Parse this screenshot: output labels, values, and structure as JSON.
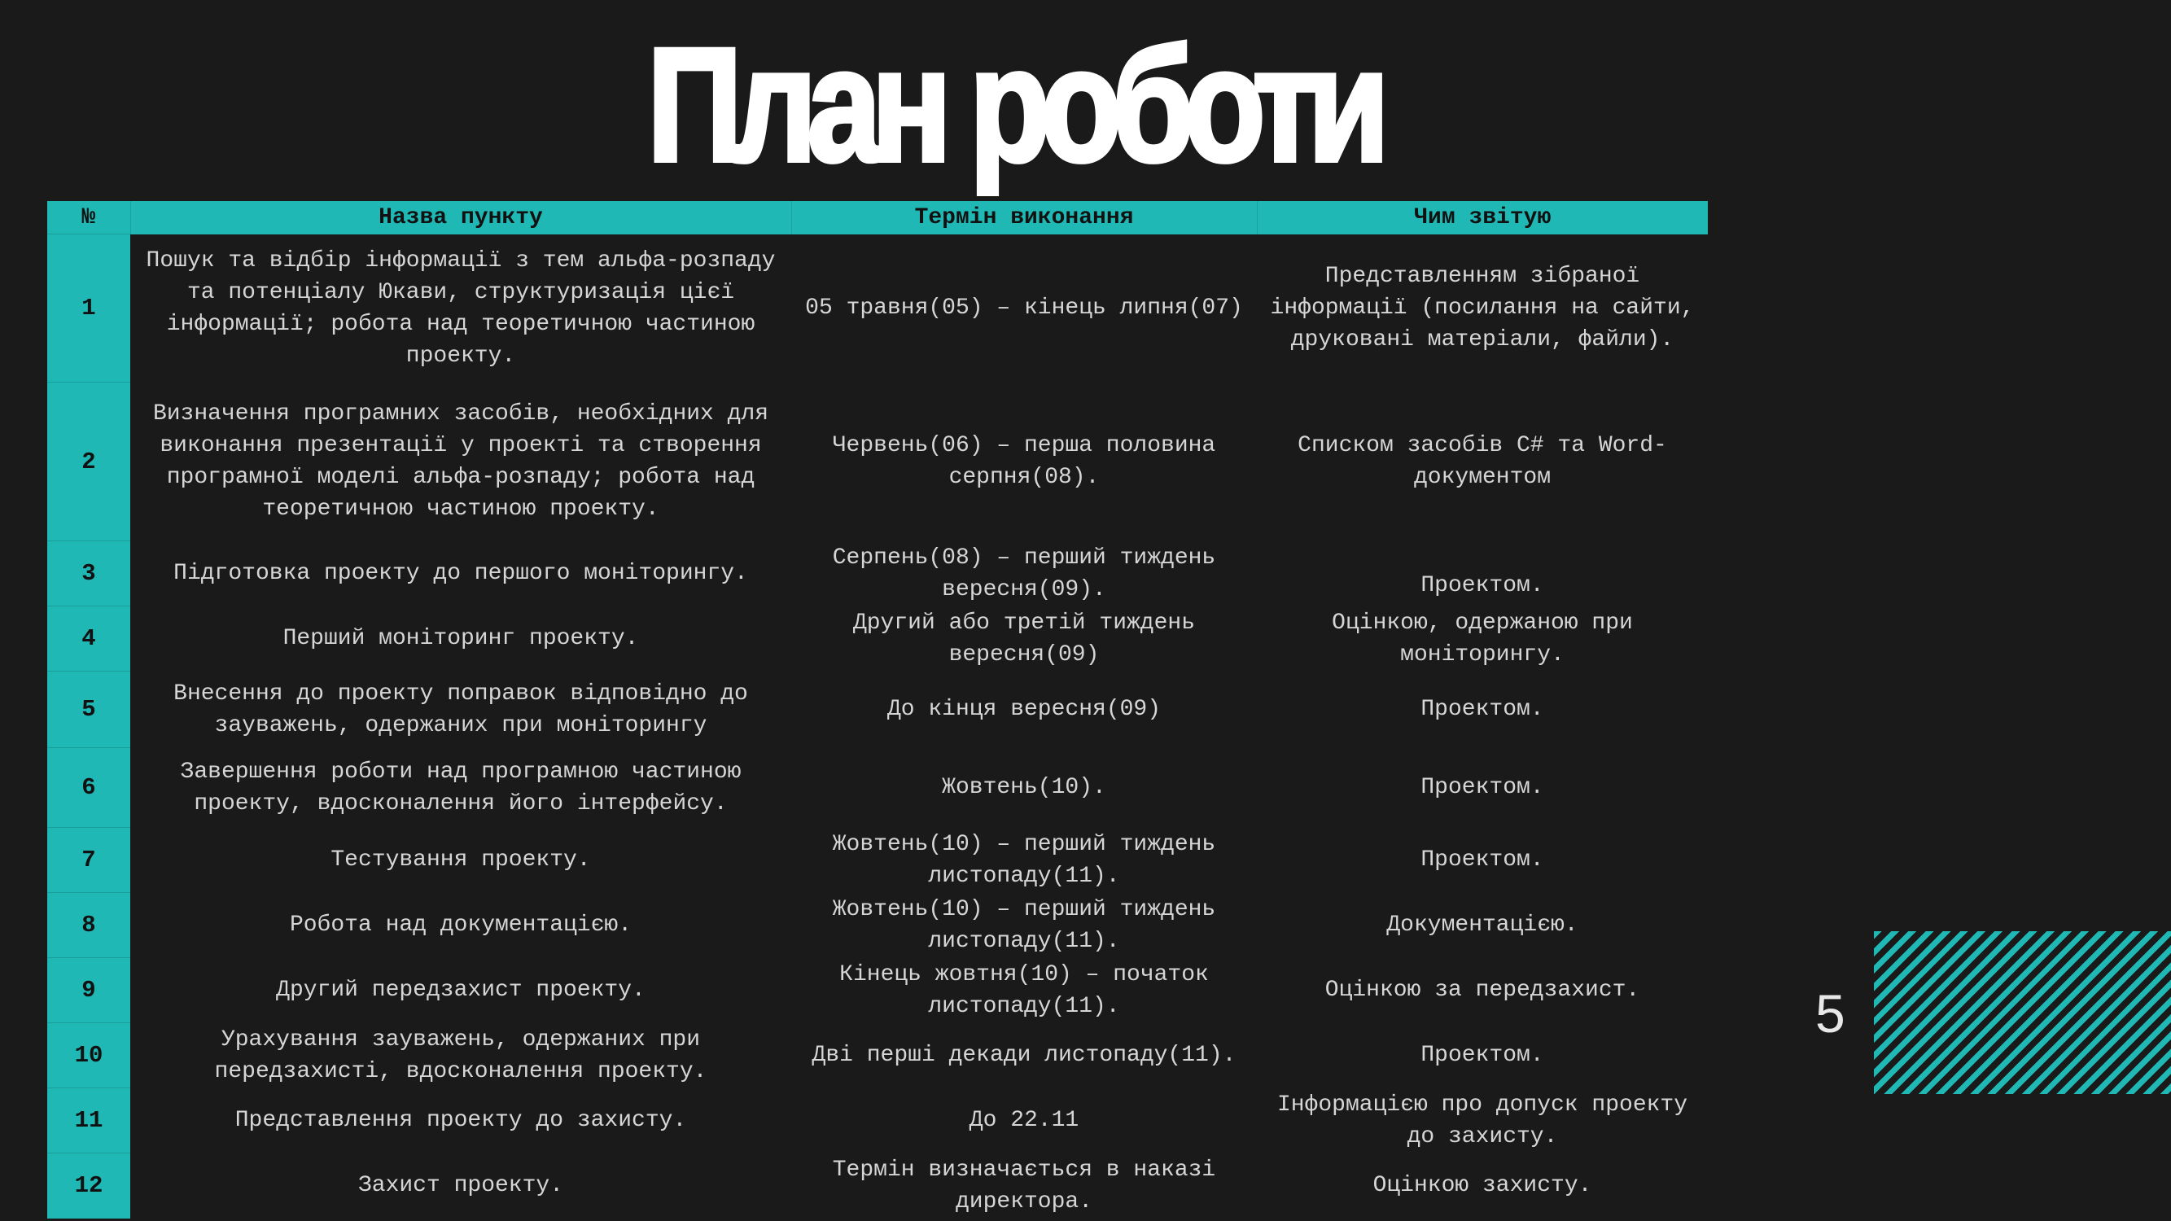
{
  "title": "План роботи",
  "page_number": "5",
  "colors": {
    "background": "#1a1a1a",
    "accent": "#1fb8b5",
    "text": "#d6d6d6",
    "title": "#ffffff"
  },
  "table": {
    "headers": {
      "number": "№",
      "name": "Назва пункту",
      "term": "Термін виконання",
      "report": "Чим звітую"
    },
    "rows": [
      {
        "number": "1",
        "name": "Пошук та відбір інформації з тем альфа-розпаду та потенціалу Юкави, структуризація цієї інформації; робота над теоретичною частиною проекту.",
        "term": "05 травня(05) – кінець липня(07)",
        "report": "Представленням зібраної інформації  (посилання на сайти, друковані матеріали, файли)."
      },
      {
        "number": "2",
        "name": "Визначення програмних засобів, необхідних для виконання презентації у проекті та створення програмної моделі альфа-розпаду; робота над теоретичною частиною проекту.",
        "term": "Червень(06) – перша половина серпня(08).",
        "report": "Списком засобів C# та Word-документом"
      },
      {
        "number": "3",
        "name": "Підготовка проекту до першого моніторингу.",
        "term": "Серпень(08) – перший тиждень вересня(09).",
        "report": "Проектом."
      },
      {
        "number": "4",
        "name": "Перший моніторинг проекту.",
        "term": "Другий або третій тиждень вересня(09)",
        "report": "Оцінкою, одержаною при моніторингу."
      },
      {
        "number": "5",
        "name": "Внесення до проекту поправок відповідно до зауважень, одержаних при моніторингу",
        "term": "До кінця вересня(09)",
        "report": "Проектом."
      },
      {
        "number": "6",
        "name": "Завершення роботи над програмною частиною проекту, вдосконалення його інтерфейсу.",
        "term": "Жовтень(10).",
        "report": "Проектом."
      },
      {
        "number": "7",
        "name": "Тестування проекту.",
        "term": "Жовтень(10) – перший тиждень листопаду(11).",
        "report": "Проектом."
      },
      {
        "number": "8",
        "name": "Робота над документацією.",
        "term": "Жовтень(10) – перший тиждень листопаду(11).",
        "report": "Документацією."
      },
      {
        "number": "9",
        "name": "Другий передзахист проекту.",
        "term": "Кінець жовтня(10) –  початок листопаду(11).",
        "report": "Оцінкою за передзахист."
      },
      {
        "number": "10",
        "name": "Урахування зауважень, одержаних при передзахисті, вдосконалення проекту.",
        "term": "Дві перші декади листопаду(11).",
        "report": "Проектом."
      },
      {
        "number": "11",
        "name": "Представлення проекту до захисту.",
        "term": "До 22.11",
        "report": "Інформацією про допуск проекту до захисту."
      },
      {
        "number": "12",
        "name": "Захист проекту.",
        "term": "Термін визначається в наказі директора.",
        "report": "Оцінкою захисту."
      }
    ]
  }
}
